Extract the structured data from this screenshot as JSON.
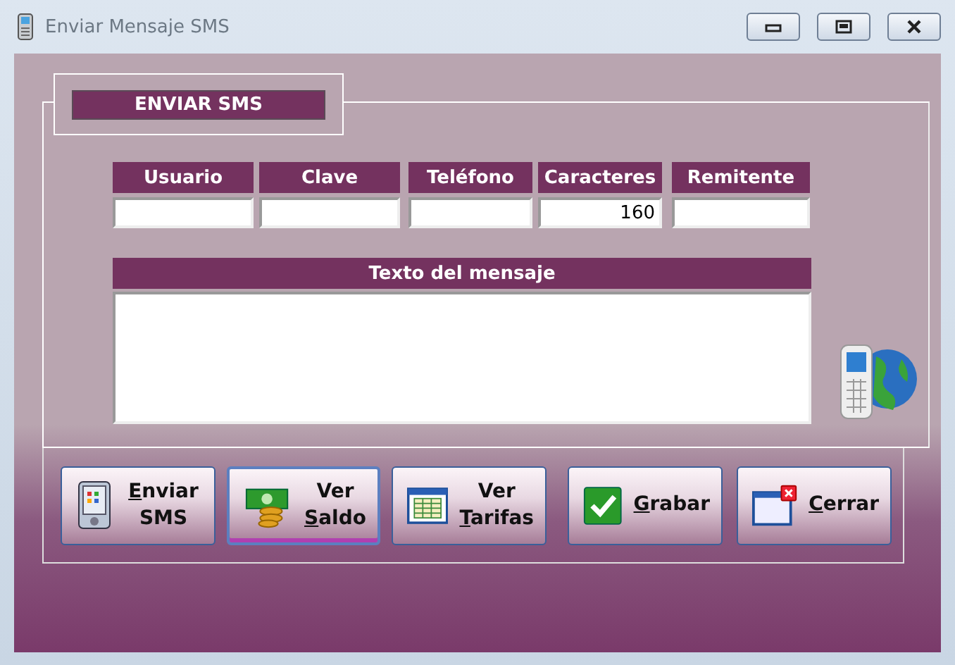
{
  "window": {
    "title": "Enviar Mensaje SMS"
  },
  "group": {
    "legend": "ENVIAR SMS"
  },
  "fields": [
    {
      "label": "Usuario"
    },
    {
      "label": "Clave"
    },
    {
      "label": "Teléfono"
    },
    {
      "label": "Caracteres",
      "value": "160"
    },
    {
      "label": "Remitente"
    }
  ],
  "message": {
    "label": "Texto del mensaje"
  },
  "buttons": [
    {
      "kind": "pda",
      "focused": false,
      "lines": [
        {
          "text": "Enviar",
          "mnemonic": true
        },
        {
          "text": "SMS",
          "mnemonic": false
        }
      ]
    },
    {
      "kind": "money",
      "focused": true,
      "lines": [
        {
          "text": "Ver",
          "mnemonic": false
        },
        {
          "text": "Saldo",
          "mnemonic": true
        }
      ]
    },
    {
      "kind": "table",
      "focused": false,
      "lines": [
        {
          "text": "Ver",
          "mnemonic": false
        },
        {
          "text": "Tarifas",
          "mnemonic": true
        }
      ]
    },
    {
      "kind": "check",
      "focused": false,
      "lines": [
        {
          "text": "Grabar",
          "mnemonic": true
        }
      ]
    },
    {
      "kind": "close",
      "focused": false,
      "lines": [
        {
          "text": "Cerrar",
          "mnemonic": true
        }
      ]
    }
  ]
}
